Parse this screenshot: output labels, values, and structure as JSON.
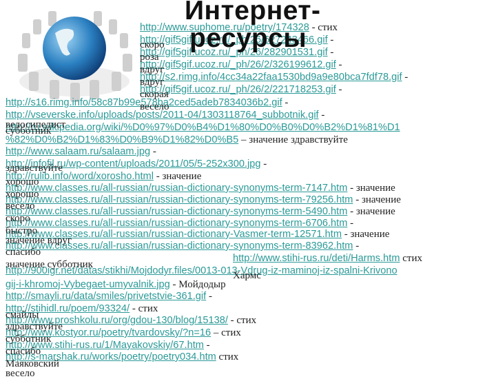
{
  "title": {
    "line1": "Интернет-",
    "line2": "ресурсы"
  },
  "colors": {
    "link": "#2b9a98",
    "text": "#222222",
    "globe": "#2a7fc0"
  },
  "rows": [
    {
      "url": "http://www.suphome.ru/poetry/174328",
      "suffix": " - стих"
    },
    {
      "url": "http://gif5gif.ucoz.ru/_ph/26/627243466.gif",
      "suffix": " -"
    },
    {
      "url": "http://gif5gif.ucoz.ru/_ph/26/282901531.gif",
      "suffix": " -"
    },
    {
      "url": "http://gif5gif.ucoz.ru/_ph/26/2/326199612.gif",
      "suffix": " -"
    },
    {
      "url": "http://s2.rimg.info/4cc34a22faa1530bd9a9e80bca7fdf78.gif",
      "suffix": " -"
    },
    {
      "url": "http://gif5gif.ucoz.ru/_ph/26/2/221718253.gif",
      "suffix": " -"
    },
    {
      "url": "http://s16.rimg.info/58c87b99e578ba2ced5adeb7834036b2.gif",
      "suffix": " -"
    },
    {
      "url": "http://vseverske.info/uploads/posts/2011-04/1303118764_subbotnik.gif",
      "suffix": " -"
    },
    {
      "url": "http://ru.wikipedia.org/wiki/%D0%97%D0%B4%D1%80%D0%B0%D0%B2%D1%81%D1",
      "suffix": ""
    },
    {
      "url": "%82%D0%B2%D1%83%D0%B9%D1%82%D0%B5",
      "suffix": " – значение здравствуйте"
    },
    {
      "url": "http://www.salaam.ru/salaam.jpg",
      "suffix": " -"
    },
    {
      "url": "http://infofil.ru/wp-content/uploads/2011/05/5-252x300.jpg",
      "suffix": " -"
    },
    {
      "url": "http://rulib.info/word/xorosho.html",
      "suffix": " - значение"
    },
    {
      "url": "http://www.classes.ru/all-russian/russian-dictionary-synonyms-term-7147.htm",
      "suffix": " - значение"
    },
    {
      "url": "http://www.classes.ru/all-russian/russian-dictionary-synonyms-term-79256.htm",
      "suffix": " - значение"
    },
    {
      "url": "http://www.classes.ru/all-russian/russian-dictionary-synonyms-term-5490.htm",
      "suffix": " - значение"
    },
    {
      "url": "http://www.classes.ru/all-russian/russian-dictionary-synonyms-term-6706.htm",
      "suffix": " -"
    },
    {
      "url": "http://www.classes.ru/all-russian/russian-dictionary-Vasmer-term-12571.htm",
      "suffix": " - значение"
    },
    {
      "url": "http://www.classes.ru/all-russian/russian-dictionary-synonyms-term-83962.htm",
      "suffix": " -"
    },
    {
      "url": "http://www.stihi-rus.ru/deti/Harms.htm",
      "suffix": " стих"
    },
    {
      "url": "http://900igr.net/datas/stikhi/Mojdodyr.files/0013-013-Vdrug-iz-maminoj-iz-spalni-Krivono",
      "suffix": ""
    },
    {
      "url": "gij-i-khromoj-Vybegaet-umyvalnik.jpg",
      "suffix": " - Мойдодыр"
    },
    {
      "url": "http://smayli.ru/data/smiles/privetstvie-361.gif",
      "suffix": " -"
    },
    {
      "url": "http://stihidl.ru/poem/93324/",
      "suffix": " - стих"
    },
    {
      "url": "http://www.proshkolu.ru/org/gdou-130/blog/15138/",
      "suffix": " - стих"
    },
    {
      "url": "http://www.kostyor.ru/poetry/tvardovsky/?n=16",
      "suffix": " – стих"
    },
    {
      "url": "http://www.stihi-rus.ru/1/Mayakovskiy/67.htm",
      "suffix": " -"
    },
    {
      "url": "http://s-marshak.ru/works/poetry/poetry034.htm",
      "suffix": " стих"
    }
  ],
  "overlays": [
    "скоро",
    "роза",
    "вдруг",
    "вдруг",
    "скорая",
    "весело",
    "велосипедист",
    "субботник",
    "здравствуйте",
    "хорошо",
    "хорошо",
    "весело",
    "скоро",
    "быстро",
    "значение вдруг",
    "спасибо",
    "значение субботник",
    "Хармс",
    "смайлы",
    "здравствуйте",
    "субботник",
    "спасибо",
    "Маяковский",
    "весело"
  ]
}
